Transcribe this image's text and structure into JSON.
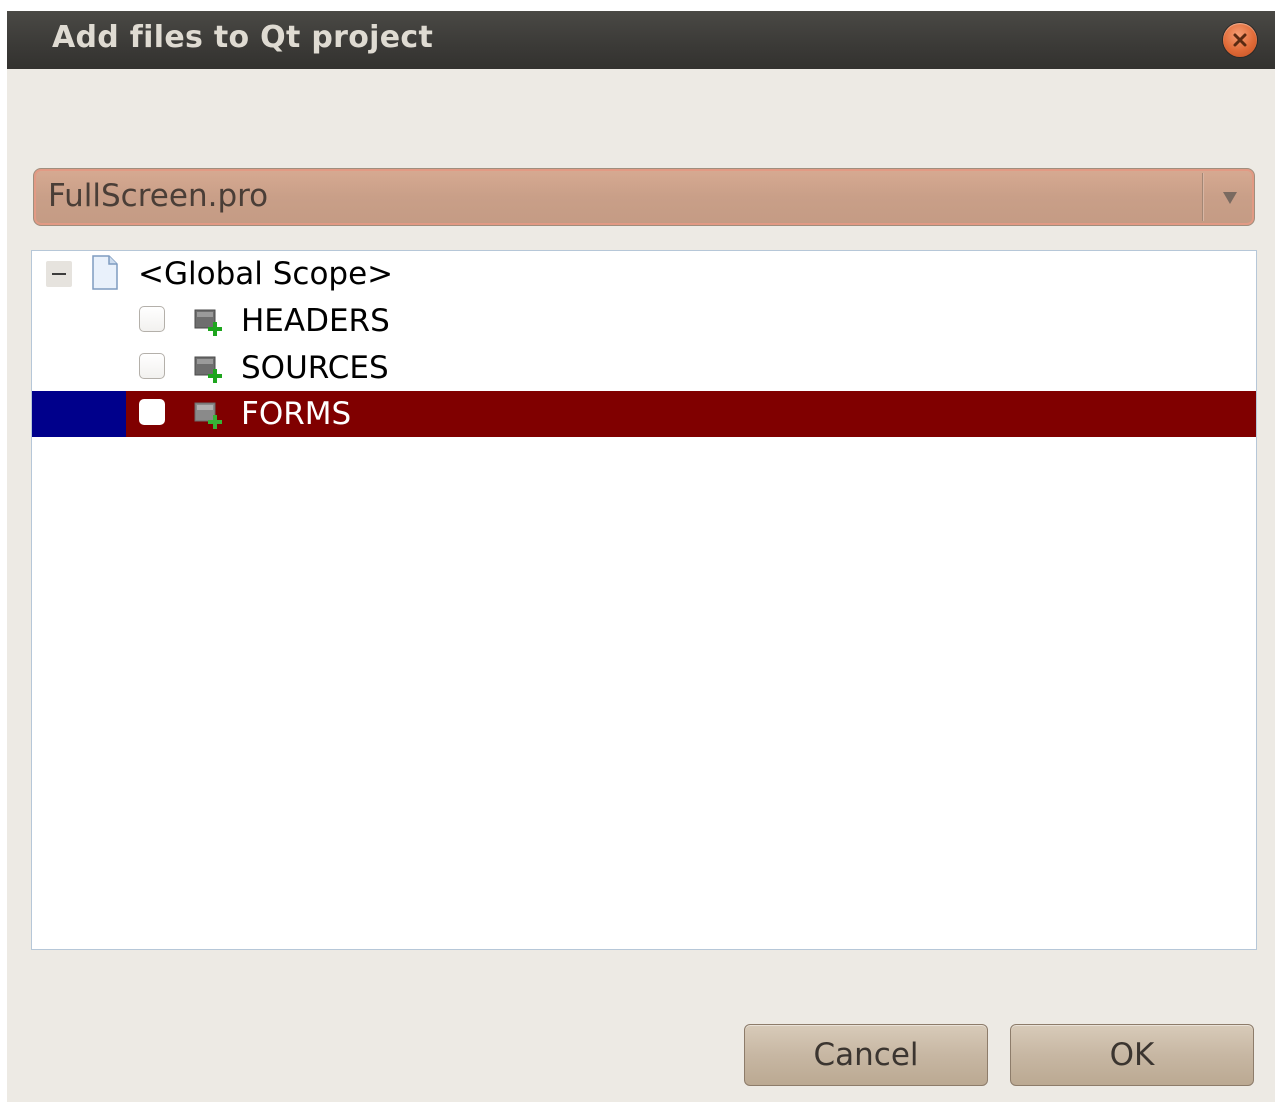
{
  "window": {
    "title": "Add files to Qt project",
    "close_icon": "close-icon"
  },
  "project_select": {
    "value": "FullScreen.pro",
    "arrow_icon": "dropdown-arrow-icon"
  },
  "tree": {
    "root": {
      "label": "<Global Scope>",
      "expanded": true,
      "icon": "file-icon"
    },
    "items": [
      {
        "label": "HEADERS",
        "checked": false,
        "selected": false,
        "icon": "folder-add-icon"
      },
      {
        "label": "SOURCES",
        "checked": false,
        "selected": false,
        "icon": "folder-add-icon"
      },
      {
        "label": "FORMS",
        "checked": false,
        "selected": true,
        "icon": "folder-add-icon"
      }
    ]
  },
  "buttons": {
    "cancel_label": "Cancel",
    "ok_label": "OK"
  },
  "colors": {
    "selection_main": "#800000",
    "selection_indent": "#00008b",
    "titlebar": "#3b3a37",
    "dialog_bg": "#edeae4",
    "close_button": "#e06a37"
  }
}
